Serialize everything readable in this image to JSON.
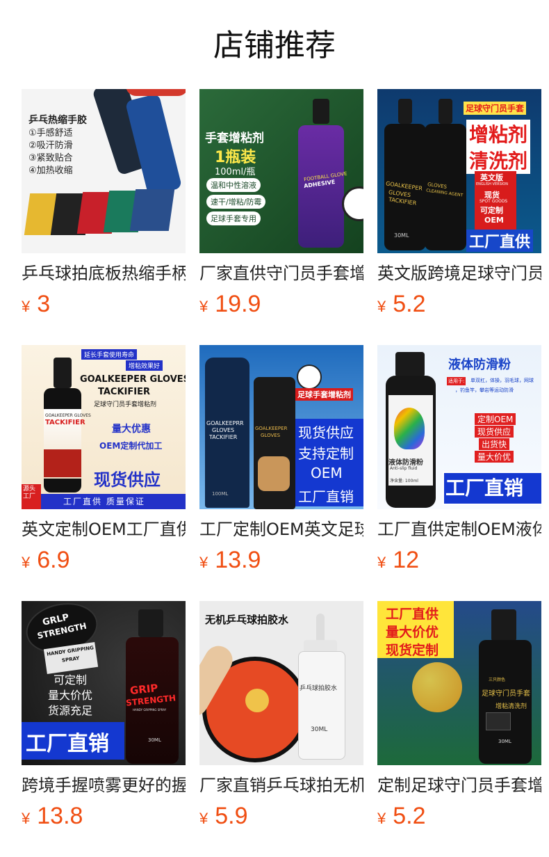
{
  "page": {
    "title": "店铺推荐"
  },
  "products": [
    {
      "name": "乒乓球拍底板热缩手柄套",
      "currency": "¥",
      "price": "3",
      "image_text": [
        "乒乓热缩手胶",
        "①手感舒适",
        "②吸汗防滑",
        "③紧致贴合",
        "④加热收缩"
      ]
    },
    {
      "name": "厂家直供守门员手套增粘剂",
      "currency": "¥",
      "price": "19.9",
      "image_text": [
        "手套增粘剂",
        "1瓶装",
        "100ml/瓶",
        "温和中性溶液",
        "速干/增粘/防霉",
        "足球手套专用",
        "FOOTBALL GLOVE",
        "ADHESIVE"
      ]
    },
    {
      "name": "英文版跨境足球守门员手套增粘剂",
      "currency": "¥",
      "price": "5.2",
      "image_text": [
        "足球守门员手套",
        "增粘剂",
        "清洗剂",
        "英文版",
        "ENGLISH VERSION",
        "现货",
        "SPOT GOODS",
        "可定制",
        "OEM",
        "工厂直供",
        "GOALKEEPER",
        "GLOVES",
        "TACKIFIER",
        "CLEANING AGENT",
        "30ML"
      ]
    },
    {
      "name": "英文定制OEM工厂直供守门员手套增粘剂",
      "currency": "¥",
      "price": "6.9",
      "image_text": [
        "延长手套使用寿命",
        "增粘效果好",
        "GOALKEEPER GLOVES",
        "TACKIFIER",
        "足球守门员手套增粘剂",
        "量大优惠",
        "OEM定制代加工",
        "现货供应",
        "源头工厂",
        "工厂直供 质量保证",
        "GOALKEEPER GLOVES",
        "TACKIFIER"
      ]
    },
    {
      "name": "工厂定制OEM英文足球守门员手套增粘剂",
      "currency": "¥",
      "price": "13.9",
      "image_text": [
        "足球手套增粘剂",
        "现货供应",
        "支持定制",
        "OEM",
        "工厂直销",
        "GOALKEEPRR",
        "GLOVES",
        "TACKIFIER",
        "GOALKEEPER",
        "GLOVES",
        "100ML"
      ]
    },
    {
      "name": "工厂直供定制OEM液体防滑粉",
      "currency": "¥",
      "price": "12",
      "image_text": [
        "液体防滑粉",
        "适用于:",
        "单双杠，体操，羽毛球，网球",
        "，钓鱼竿，攀岩等运动防滑",
        "定制OEM",
        "现货供应",
        "出货快",
        "量大价优",
        "工厂直销",
        "液体防滑粉",
        "Anti-slip fluid",
        "净含量: 100ml"
      ]
    },
    {
      "name": "跨境手握喷雾更好的握力",
      "currency": "¥",
      "price": "13.8",
      "image_text": [
        "GRLP",
        "STRENGTH",
        "HANDY GRIPPING",
        "SPRAY",
        "可定制",
        "量大价优",
        "货源充足",
        "工厂直销",
        "GRIP",
        "STRENGTH",
        "HANDY GRIPPING SPRAY",
        "30ML"
      ]
    },
    {
      "name": "厂家直销乒乓球拍无机胶水",
      "currency": "¥",
      "price": "5.9",
      "image_text": [
        "无机乒乓球拍胶水",
        "乒乓球拍胶水",
        "30ML"
      ]
    },
    {
      "name": "定制足球守门员手套增粘剂",
      "currency": "¥",
      "price": "5.2",
      "image_text": [
        "工厂直供",
        "量大价优",
        "现货定制",
        "三只颜色",
        "足球守门员手套",
        "增粘清洗剂",
        "30ML"
      ]
    }
  ],
  "colors": {
    "price": "#f04e12",
    "title": "#111111"
  }
}
